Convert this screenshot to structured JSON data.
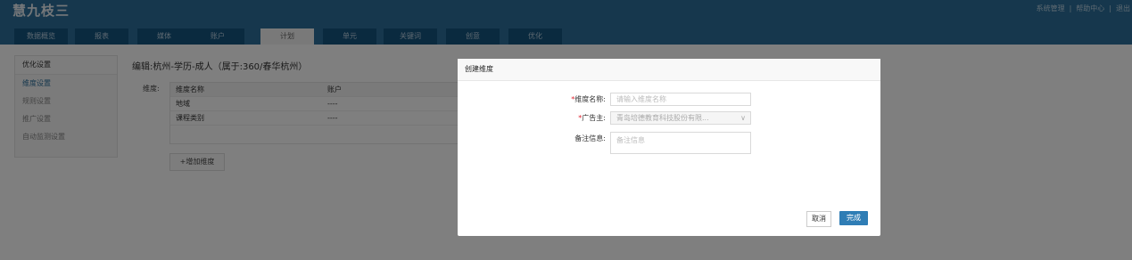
{
  "header": {
    "logo": "慧九枝三",
    "links": [
      "系统管理",
      "帮助中心",
      "退出"
    ],
    "separator": "|"
  },
  "nav": {
    "tabs": [
      {
        "label": "数据概览",
        "active": false
      },
      {
        "label": "报表",
        "active": false
      },
      {
        "label": "媒体",
        "active": false
      },
      {
        "label": "账户",
        "active": false
      },
      {
        "label": "计划",
        "active": true
      },
      {
        "label": "单元",
        "active": false
      },
      {
        "label": "关键词",
        "active": false
      },
      {
        "label": "创意",
        "active": false
      },
      {
        "label": "优化",
        "active": false
      }
    ]
  },
  "sidebar": {
    "items": [
      {
        "label": "优化设置",
        "type": "head"
      },
      {
        "label": "维度设置",
        "type": "active"
      },
      {
        "label": "规则设置",
        "type": "normal"
      },
      {
        "label": "推广设置",
        "type": "normal"
      },
      {
        "label": "自动监测设置",
        "type": "normal"
      }
    ]
  },
  "main": {
    "title": "编辑:杭州-学历-成人（属于:360/春华杭州）",
    "dimension_label": "维度:",
    "table": {
      "headers": [
        "维度名称",
        "账户"
      ],
      "rows": [
        [
          "地域",
          "----"
        ],
        [
          "课程类别",
          "----"
        ]
      ]
    },
    "add_button": "+增加维度"
  },
  "modal": {
    "title": "创建维度",
    "fields": {
      "name": {
        "required_mark": "*",
        "label": "维度名称:",
        "placeholder": "请输入维度名称"
      },
      "advertiser": {
        "required_mark": "*",
        "label": "广告主:",
        "value": "青岛培德教育科技股份有限..."
      },
      "remark": {
        "label": "备注信息:",
        "placeholder": "备注信息"
      }
    },
    "cancel_label": "取消",
    "confirm_label": "完成"
  },
  "colors": {
    "header_bg": "#2c6f9b",
    "tab_bg": "#15557f",
    "primary_button": "#2f7db5",
    "required": "#e0242f"
  },
  "icons": {
    "select_chevron": "chevron-down-icon"
  }
}
